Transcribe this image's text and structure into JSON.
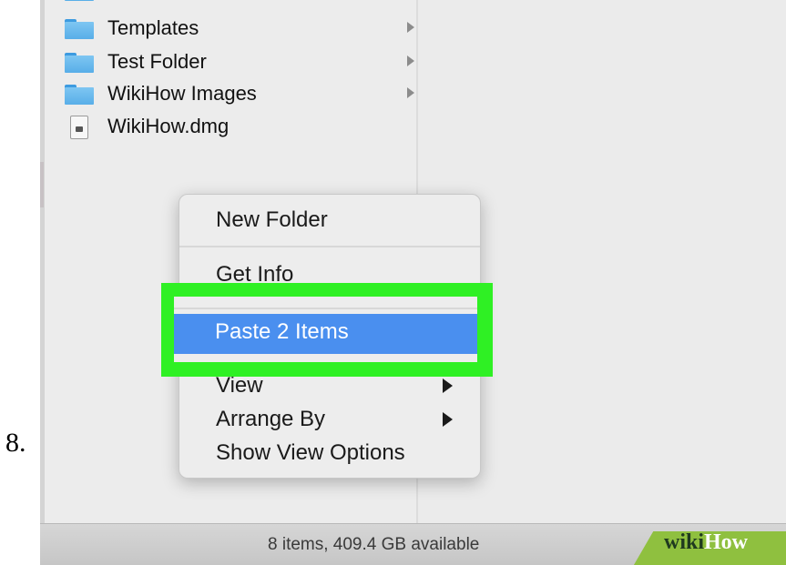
{
  "step_number": "8.",
  "files": [
    {
      "name": "Templates",
      "type": "folder",
      "icon": "folder-icon",
      "has_arrow": true
    },
    {
      "name": "Test Folder",
      "type": "folder",
      "icon": "folder-icon",
      "has_arrow": true
    },
    {
      "name": "WikiHow Images",
      "type": "folder",
      "icon": "folder-icon",
      "has_arrow": true
    },
    {
      "name": "WikiHow.dmg",
      "type": "disk-image",
      "icon": "disk-image-icon",
      "has_arrow": false
    }
  ],
  "context_menu": {
    "new_folder": "New Folder",
    "get_info": "Get Info",
    "paste_items": "Paste 2 Items",
    "view": "View",
    "arrange_by": "Arrange By",
    "show_view_options": "Show View Options"
  },
  "status_bar": {
    "text": "8 items, 409.4 GB available"
  },
  "watermark": {
    "wiki": "wiki",
    "how": "How"
  },
  "colors": {
    "highlight_frame": "#2ff024",
    "selected_item": "#4a8fef",
    "folder": "#58aee8",
    "watermark_bg": "#8fc03f"
  }
}
